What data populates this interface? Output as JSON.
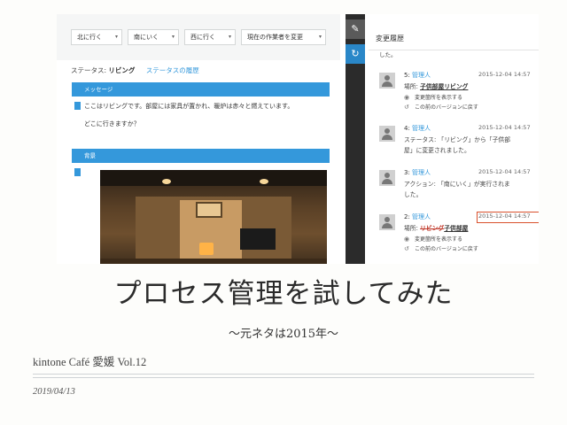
{
  "app": {
    "nav_buttons": [
      "北に行く",
      "南にいく",
      "西に行く",
      "現在の作業者を変更"
    ],
    "status_label": "ステータス:",
    "status_value": "リビング",
    "status_history_link": "ステータスの履歴",
    "message_header": "メッセージ",
    "message_line1": "ここはリビングです。部屋には家具が置かれ、暖炉は赤々と燃えています。",
    "message_line2": "どこに行きますか？",
    "background_header": "背景"
  },
  "history": {
    "title": "変更履歴",
    "top_text": "した。",
    "entries": [
      {
        "num": "5:",
        "user": "管理人",
        "time": "2015-12-04 14:57",
        "line1_label": "場所:",
        "line1_value": "子供部屋リビング",
        "actions": [
          "変更箇所を表示する",
          "この前のバージョンに戻す"
        ]
      },
      {
        "num": "4:",
        "user": "管理人",
        "time": "2015-12-04 14:57",
        "line1": "ステータス: 「リビング」から「子供部",
        "line2": "屋」に変更されました。"
      },
      {
        "num": "3:",
        "user": "管理人",
        "time": "2015-12-04 14:57",
        "line1": "アクション: 「南にいく」が実行されま",
        "line2": "した。"
      },
      {
        "num": "2:",
        "user": "管理人",
        "time": "2015-12-04 14:57",
        "line1_label": "場所:",
        "line1_strike": "リビング",
        "line1_value": "子供部屋",
        "actions": [
          "変更箇所を表示する",
          "この前のバージョンに戻す"
        ]
      }
    ]
  },
  "slide": {
    "title": "プロセス管理を試してみた",
    "subtitle": "〜元ネタは2015年〜",
    "event": "kintone Café 愛媛 Vol.12",
    "date": "2019/04/13"
  },
  "colors": {
    "accent": "#3498db",
    "highlight_box": "#d9502c",
    "strip": "#2b2b2b"
  }
}
